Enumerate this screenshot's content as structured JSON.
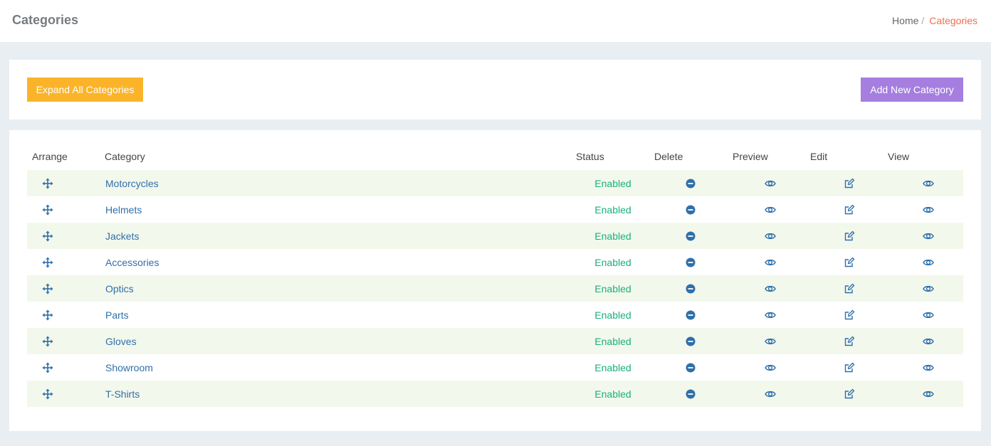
{
  "header": {
    "title": "Categories",
    "breadcrumb": {
      "home": "Home",
      "separator": "/",
      "current": "Categories"
    }
  },
  "actions": {
    "expand_label": "Expand All Categories",
    "add_label": "Add New Category"
  },
  "table": {
    "columns": {
      "arrange": "Arrange",
      "category": "Category",
      "status": "Status",
      "delete": "Delete",
      "preview": "Preview",
      "edit": "Edit",
      "view": "View"
    },
    "rows": [
      {
        "category": "Motorcycles",
        "status": "Enabled"
      },
      {
        "category": "Helmets",
        "status": "Enabled"
      },
      {
        "category": "Jackets",
        "status": "Enabled"
      },
      {
        "category": "Accessories",
        "status": "Enabled"
      },
      {
        "category": "Optics",
        "status": "Enabled"
      },
      {
        "category": "Parts",
        "status": "Enabled"
      },
      {
        "category": "Gloves",
        "status": "Enabled"
      },
      {
        "category": "Showroom",
        "status": "Enabled"
      },
      {
        "category": "T-Shirts",
        "status": "Enabled"
      }
    ]
  },
  "icons": {
    "arrange": "move-icon",
    "delete": "minus-circle-icon",
    "preview": "eye-icon",
    "edit": "edit-icon",
    "view": "eye-icon"
  },
  "colors": {
    "expand_button": "#fbb429",
    "add_button": "#a57ee0",
    "status_enabled": "#19b07b",
    "link": "#2f6fab",
    "breadcrumb_active": "#f26d4f",
    "row_stripe": "#f3f8ec"
  }
}
